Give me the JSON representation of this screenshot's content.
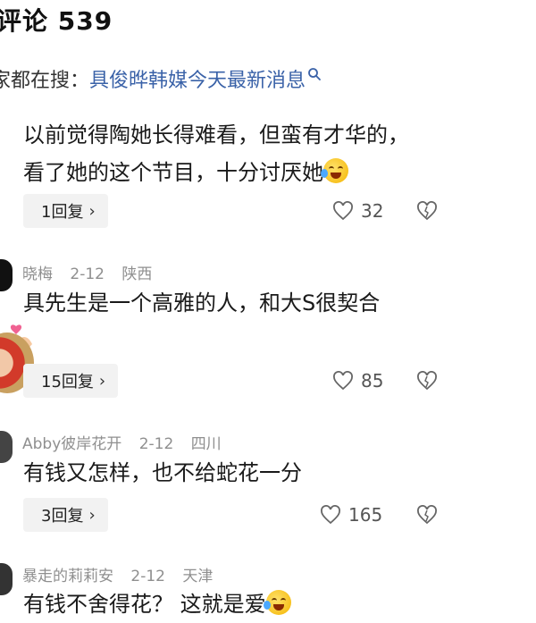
{
  "header": {
    "title": "评论 539"
  },
  "search": {
    "prefix": "家都在搜：",
    "query": "具俊晔韩媒今天最新消息"
  },
  "comments": [
    {
      "author": "",
      "date": "",
      "location": "",
      "lines": [
        "以前觉得陶她长得难看，但蛮有才华的，",
        "看了她的这个节目，十分讨厌她"
      ],
      "has_emoji": true,
      "reply_label": "1回复",
      "likes": "32"
    },
    {
      "author": "晓梅",
      "date": "2-12",
      "location": "陕西",
      "lines": [
        "具先生是一个高雅的人，和大S很契合"
      ],
      "reply_label": "15回复",
      "likes": "85"
    },
    {
      "author": "Abby彼岸花开",
      "date": "2-12",
      "location": "四川",
      "lines": [
        "有钱又怎样，也不给蛇花一分"
      ],
      "reply_label": "3回复",
      "likes": "165"
    },
    {
      "author": "暴走的莉莉安",
      "date": "2-12",
      "location": "天津",
      "lines": [
        "有钱不舍得花？ 这就是爱"
      ],
      "has_emoji": true
    }
  ],
  "colors": {
    "link": "#3a62a8",
    "meta": "#8f8f8f",
    "button_bg": "#f2f2f2"
  }
}
